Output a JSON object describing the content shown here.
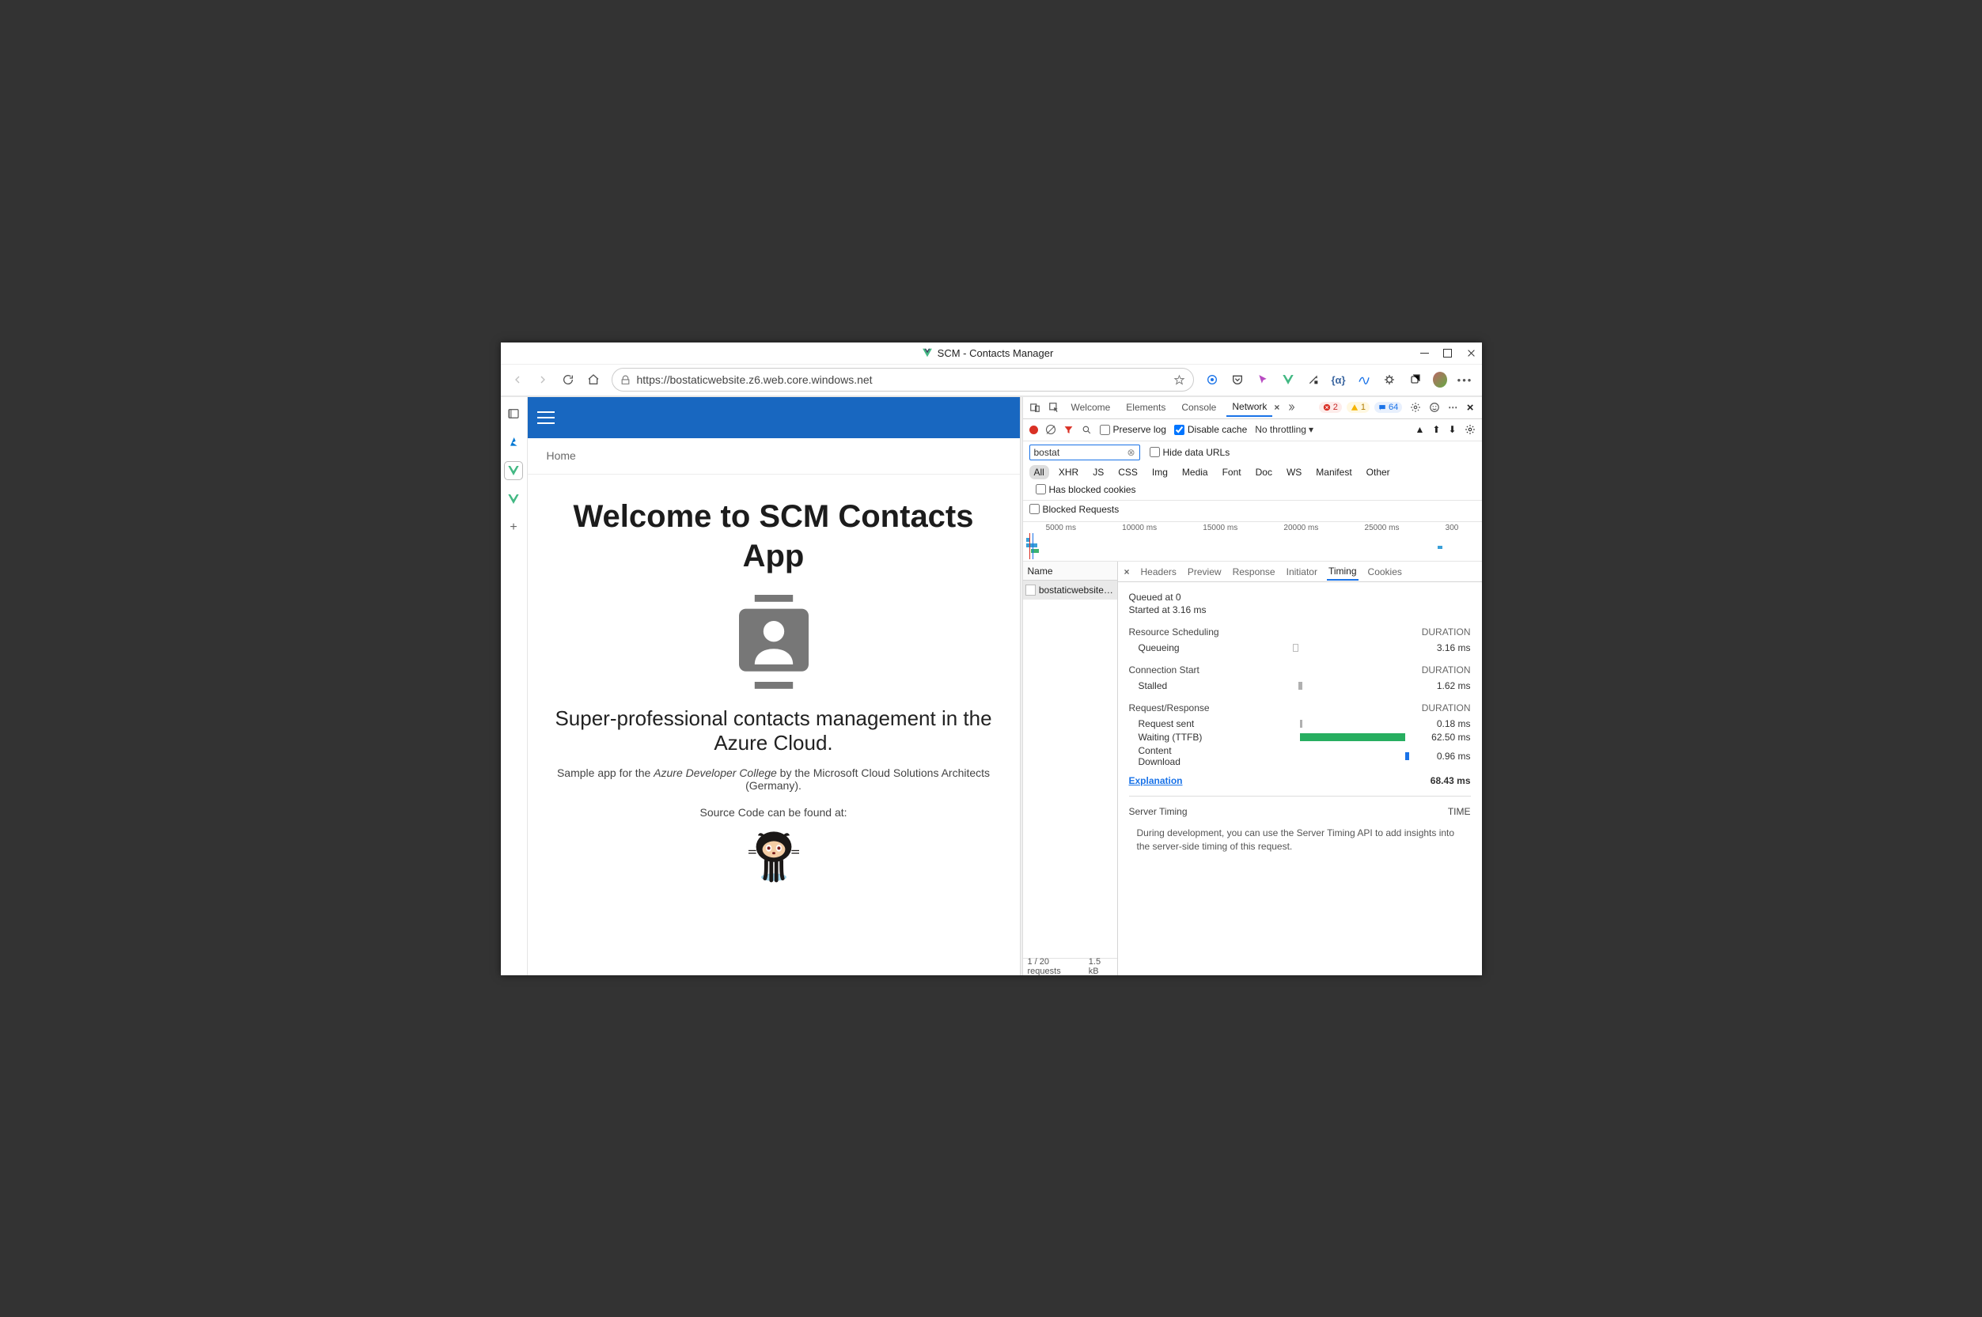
{
  "window": {
    "title": "SCM - Contacts Manager"
  },
  "toolbar": {
    "url": "https://bostaticwebsite.z6.web.core.windows.net"
  },
  "app": {
    "breadcrumb": "Home",
    "hero_title": "Welcome to SCM Contacts App",
    "subtitle": "Super-professional contacts management in the Azure Cloud.",
    "desc_prefix": "Sample app for the ",
    "desc_em": "Azure Developer College",
    "desc_suffix": " by the Microsoft Cloud Solutions Architects (Germany).",
    "source_label": "Source Code can be found at:"
  },
  "devtools": {
    "tabs": {
      "welcome": "Welcome",
      "elements": "Elements",
      "console": "Console",
      "network": "Network"
    },
    "badges": {
      "errors": "2",
      "warnings": "1",
      "messages": "64"
    },
    "controls": {
      "preserve_log": "Preserve log",
      "disable_cache": "Disable cache",
      "throttling": "No throttling"
    },
    "filter_value": "bostat",
    "hide_data_urls": "Hide data URLs",
    "types": [
      "All",
      "XHR",
      "JS",
      "CSS",
      "Img",
      "Media",
      "Font",
      "Doc",
      "WS",
      "Manifest",
      "Other"
    ],
    "has_blocked_cookies": "Has blocked cookies",
    "blocked_requests": "Blocked Requests",
    "ticks": [
      "5000 ms",
      "10000 ms",
      "15000 ms",
      "20000 ms",
      "25000 ms",
      "300"
    ],
    "request_list": {
      "header": "Name",
      "row0": "bostaticwebsite.z...",
      "status_req": "1 / 20 requests",
      "status_size": "1.5 kB"
    },
    "detail_tabs": {
      "headers": "Headers",
      "preview": "Preview",
      "response": "Response",
      "initiator": "Initiator",
      "timing": "Timing",
      "cookies": "Cookies"
    },
    "timing": {
      "queued": "Queued at 0",
      "started": "Started at 3.16 ms",
      "sections": {
        "scheduling": "Resource Scheduling",
        "connection": "Connection Start",
        "request": "Request/Response",
        "duration_label": "DURATION"
      },
      "rows": {
        "queueing_label": "Queueing",
        "queueing_val": "3.16 ms",
        "stalled_label": "Stalled",
        "stalled_val": "1.62 ms",
        "sent_label": "Request sent",
        "sent_val": "0.18 ms",
        "waiting_label": "Waiting (TTFB)",
        "waiting_val": "62.50 ms",
        "download_label": "Content Download",
        "download_val": "0.96 ms"
      },
      "explanation": "Explanation",
      "total": "68.43 ms",
      "server_timing": "Server Timing",
      "time_label": "TIME",
      "server_timing_note": "During development, you can use the Server Timing API to add insights into the server-side timing of this request."
    }
  }
}
